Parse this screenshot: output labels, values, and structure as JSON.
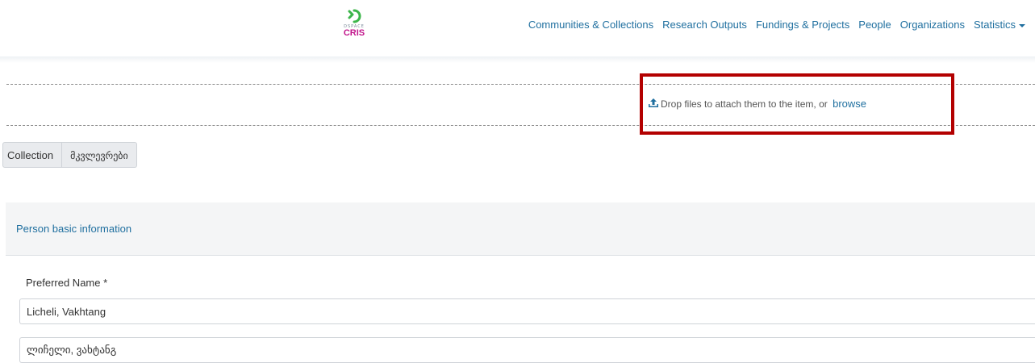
{
  "navbar": {
    "logo": {
      "brand_top": "DSPACE",
      "brand_bottom": "CRIS"
    },
    "items": [
      {
        "label": "Communities & Collections"
      },
      {
        "label": "Research Outputs"
      },
      {
        "label": "Fundings & Projects"
      },
      {
        "label": "People"
      },
      {
        "label": "Organizations"
      },
      {
        "label": "Statistics",
        "has_caret": true
      }
    ]
  },
  "dropzone": {
    "message": "Drop files to attach them to the item, or",
    "browse_label": "browse",
    "icon": "upload-icon",
    "highlight_color": "#b30000"
  },
  "collection_selector": {
    "label": "Collection",
    "value": "მკვლევრები"
  },
  "section": {
    "title": "Person basic information"
  },
  "form": {
    "preferred_name_label": "Preferred Name *",
    "preferred_name_value": "Licheli, Vakhtang",
    "preferred_name_alt_value": "ლიჩელი, ვახტანგ"
  },
  "colors": {
    "link": "#1f6f9f",
    "text": "#333333",
    "logo_green": "#3cb54a",
    "logo_magenta": "#c2168c"
  }
}
